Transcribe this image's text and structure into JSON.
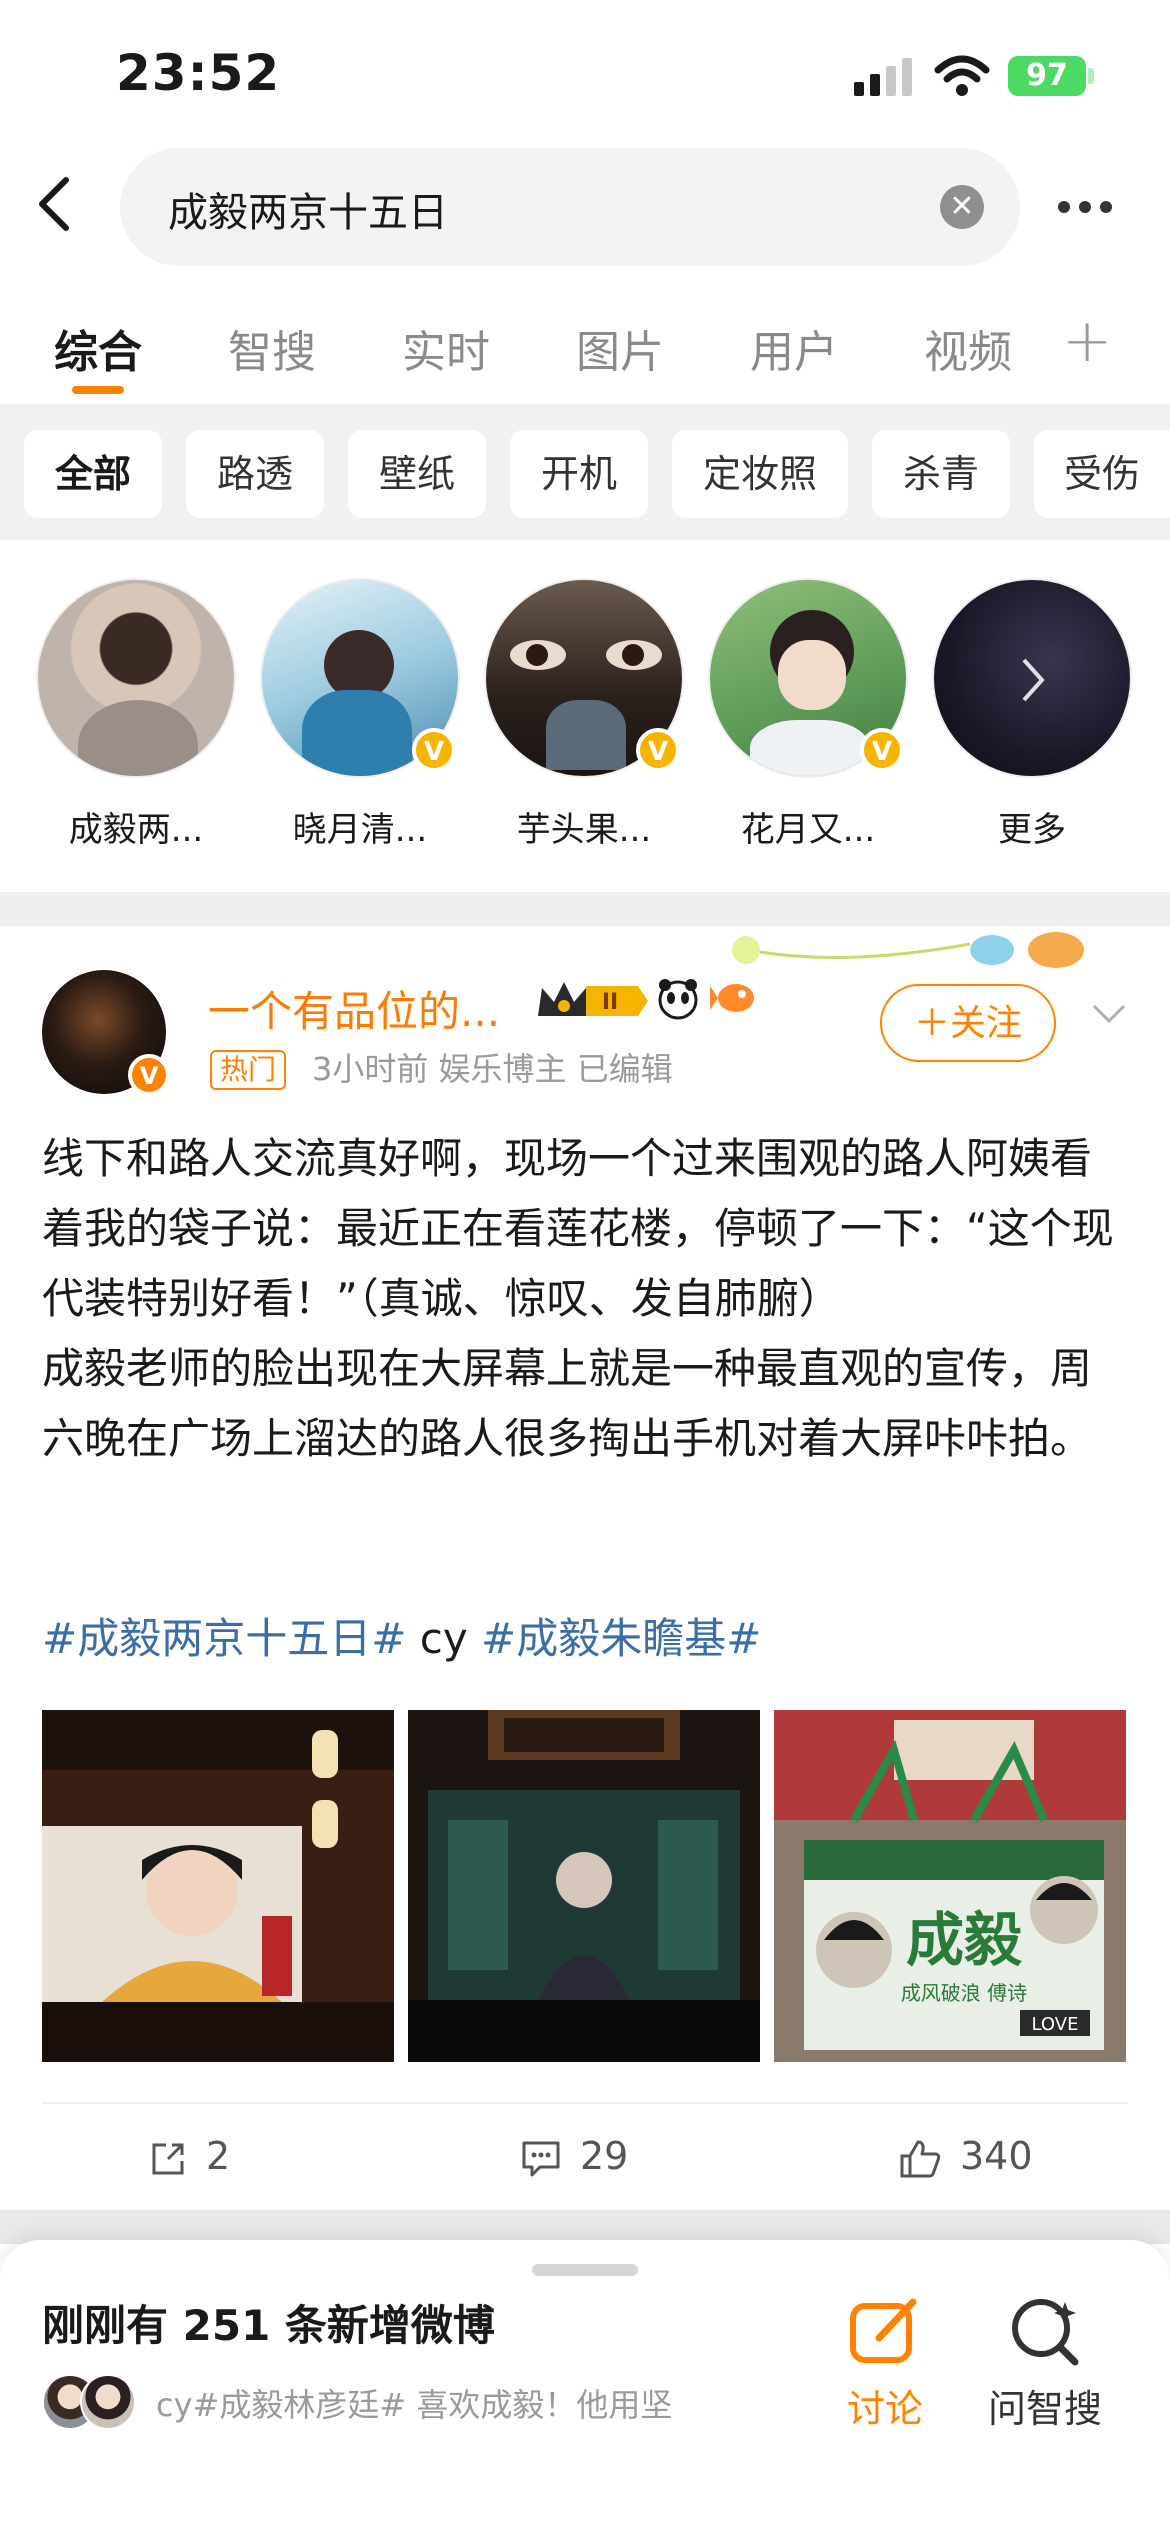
{
  "status_bar": {
    "time": "23:52",
    "battery": "97"
  },
  "search": {
    "query": "成毅两京十五日"
  },
  "tabs": [
    {
      "label": "综合",
      "active": true
    },
    {
      "label": "智搜"
    },
    {
      "label": "实时"
    },
    {
      "label": "图片"
    },
    {
      "label": "用户"
    },
    {
      "label": "视频"
    }
  ],
  "chips": [
    "全部",
    "路透",
    "壁纸",
    "开机",
    "定妆照",
    "杀青",
    "受伤"
  ],
  "avatars": [
    {
      "label": "成毅两..."
    },
    {
      "label": "晓月清..."
    },
    {
      "label": "芋头果..."
    },
    {
      "label": "花月又..."
    },
    {
      "label": "更多"
    }
  ],
  "post": {
    "author": "一个有品位的...",
    "level": "II",
    "hot_tag": "热门",
    "meta": "3小时前  娱乐博主  已编辑",
    "follow_label": "＋关注",
    "body": "线下和路人交流真好啊，现场一个过来围观的路人阿姨看着我的袋子说：最近正在看莲花楼，停顿了一下：“这个现代装特别好看！”（真诚、惊叹、发自肺腑）\n成毅老师的脸出现在大屏幕上就是一种最直观的宣传，周六晚在广场上溜达的路人很多掏出手机对着大屏咔咔拍。",
    "tag1": "#成毅两京十五日#",
    "mid_text": " cy ",
    "tag2": "#成毅朱瞻基#",
    "image3_text": "成毅",
    "image3_sub": "成风破浪 傅诗",
    "image3_label": "LOVE",
    "reposts": "2",
    "comments": "29",
    "likes": "340"
  },
  "sheet": {
    "title": "刚刚有 251 条新增微博",
    "subtitle": "cy#成毅林彦廷# 喜欢成毅！他用坚",
    "discuss_label": "讨论",
    "ask_label": "问智搜"
  },
  "colors": {
    "accent": "#ff8200",
    "link": "#3a6ea5"
  }
}
